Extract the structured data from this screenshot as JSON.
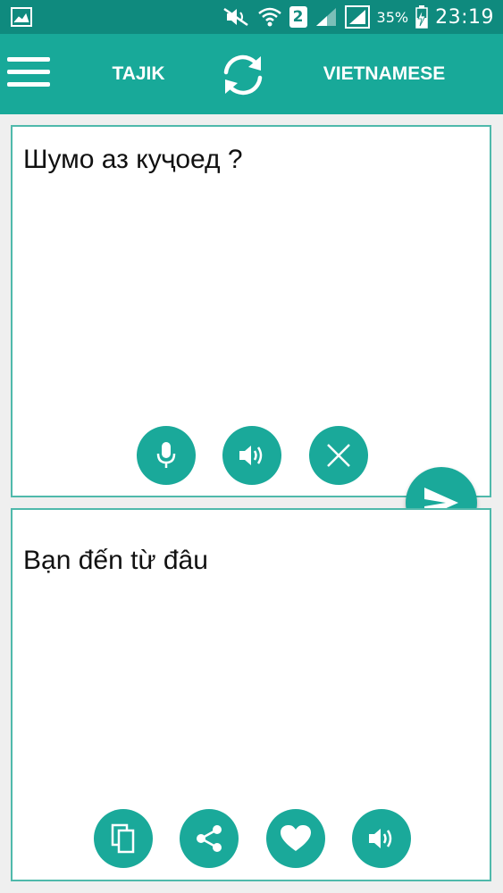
{
  "status_bar": {
    "sim_slot": "2",
    "battery_percent": "35%",
    "time": "23:19",
    "icons": [
      "gallery-icon",
      "mute-icon",
      "wifi-icon",
      "signal-icon",
      "battery-charging-icon"
    ]
  },
  "app_bar": {
    "source_language": "TAJIK",
    "target_language": "VIETNAMESE",
    "icons": [
      "menu-icon",
      "swap-languages-icon"
    ]
  },
  "source_panel": {
    "text": "Шумо аз куҷоед ?",
    "actions": [
      "microphone-icon",
      "speaker-icon",
      "clear-icon"
    ]
  },
  "target_panel": {
    "text": "Bạn đến từ đâu",
    "actions": [
      "copy-icon",
      "share-icon",
      "favorite-heart-icon",
      "speaker-icon"
    ]
  },
  "colors": {
    "status_bar": "#0f8a7e",
    "app_bar": "#18a999",
    "accent": "#1aa99a",
    "panel_border": "#4fb9ab",
    "background": "#efefef"
  }
}
